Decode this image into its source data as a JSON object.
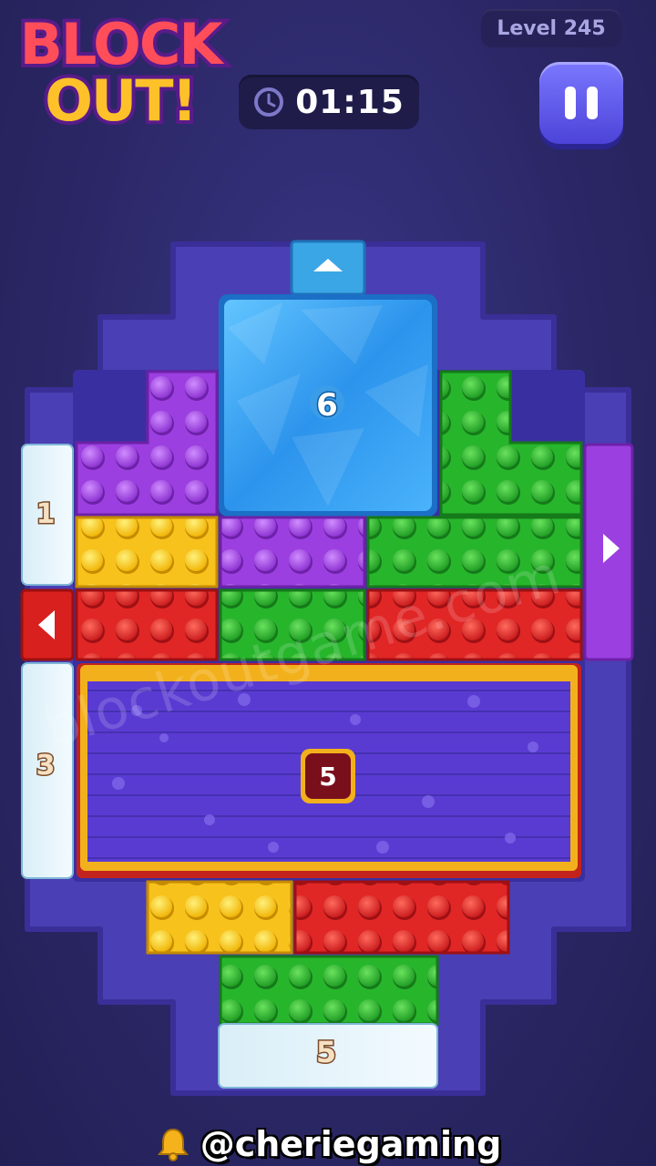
{
  "game": {
    "logo_line1": "BLOCK",
    "logo_line2": "OUT!",
    "level_label": "Level 245",
    "timer": "01:15"
  },
  "board": {
    "center_frozen_block_count": "6",
    "left_top_gate_number": "1",
    "left_bottom_gate_number": "3",
    "bottom_gate_number": "5",
    "big_block_count": "5"
  },
  "colors": {
    "purple": "#9c3fe0",
    "yellow": "#f7c21c",
    "green": "#27b52c",
    "red": "#e12626",
    "ice": "#3ea8f2",
    "frame": "#4a3fb4"
  },
  "footer": {
    "watermark": "blockoutgame.com",
    "handle": "@cheriegaming"
  }
}
